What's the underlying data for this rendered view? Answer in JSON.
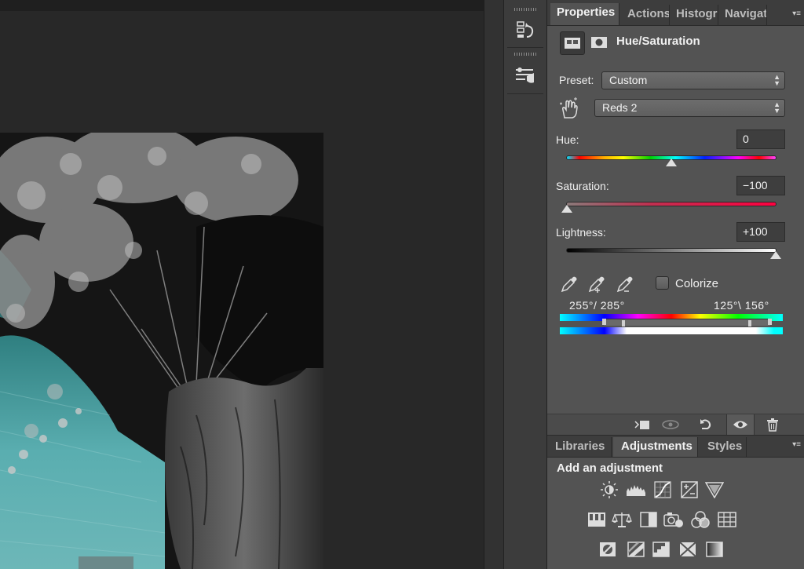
{
  "properties_panel": {
    "tabs": [
      "Properties",
      "Actions",
      "Histogr",
      "Navigat"
    ],
    "active_tab": "Properties",
    "title": "Hue/Saturation",
    "preset_label": "Preset:",
    "preset_value": "Custom",
    "channel_value": "Reds 2",
    "hue": {
      "label": "Hue:",
      "value": "0",
      "level": 0.5
    },
    "saturation": {
      "label": "Saturation:",
      "value": "−100",
      "level": 0.0
    },
    "lightness": {
      "label": "Lightness:",
      "value": "+100",
      "level": 1.0
    },
    "colorize_label": "Colorize",
    "colorize_checked": false,
    "range_left": "255°/ 285°",
    "range_right": "125°\\ 156°"
  },
  "lower_panel": {
    "tabs": [
      "Libraries",
      "Adjustments",
      "Styles"
    ],
    "active_tab": "Adjustments",
    "heading": "Add an adjustment"
  },
  "icons": {
    "toolbar": [
      "history-icon",
      "tool-presets-icon"
    ],
    "header": [
      "adjustment-mask-icon",
      "layer-mask-icon"
    ],
    "footer": [
      "clip-to-layer-icon",
      "view-previous-state-icon",
      "reset-icon",
      "visibility-icon",
      "trash-icon"
    ],
    "adjustments_row1": [
      "brightness-contrast-icon",
      "levels-icon",
      "curves-icon",
      "exposure-icon",
      "vibrance-icon"
    ],
    "adjustments_row2": [
      "hue-saturation-icon",
      "color-balance-icon",
      "black-white-icon",
      "photo-filter-icon",
      "channel-mixer-icon",
      "color-lookup-icon"
    ],
    "adjustments_row3": [
      "invert-icon",
      "posterize-icon",
      "threshold-icon",
      "selective-color-icon",
      "gradient-map-icon"
    ]
  },
  "colors": {
    "panel_bg": "#535353",
    "tab_bar_bg": "#3d3d3d",
    "canvas_bg": "#282828",
    "photo_teal": "#3a8f90"
  }
}
